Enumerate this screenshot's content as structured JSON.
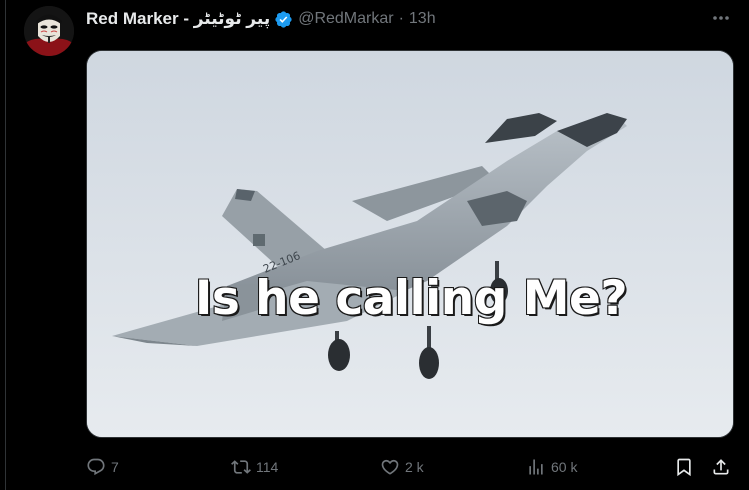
{
  "author": {
    "display_name": "Red Marker - پیر ٹوٹیٹر",
    "handle": "@RedMarkar",
    "separator": "·",
    "time": "13h",
    "verified": true
  },
  "media": {
    "caption": "Is he calling Me?",
    "aircraft_markings": "22-106"
  },
  "actions": {
    "reply_count": "7",
    "repost_count": "114",
    "like_count": "2 k",
    "views_count": "60 k"
  },
  "icons": {
    "reply": "reply-icon",
    "repost": "repost-icon",
    "like": "heart-icon",
    "views": "views-chart-icon",
    "bookmark": "bookmark-icon",
    "share": "share-icon",
    "more": "more-dots-icon",
    "verified": "verified-badge-icon"
  },
  "colors": {
    "background": "#000000",
    "text_primary": "#e7e9ea",
    "text_secondary": "#71767b",
    "verified_blue": "#1d9bf0"
  }
}
